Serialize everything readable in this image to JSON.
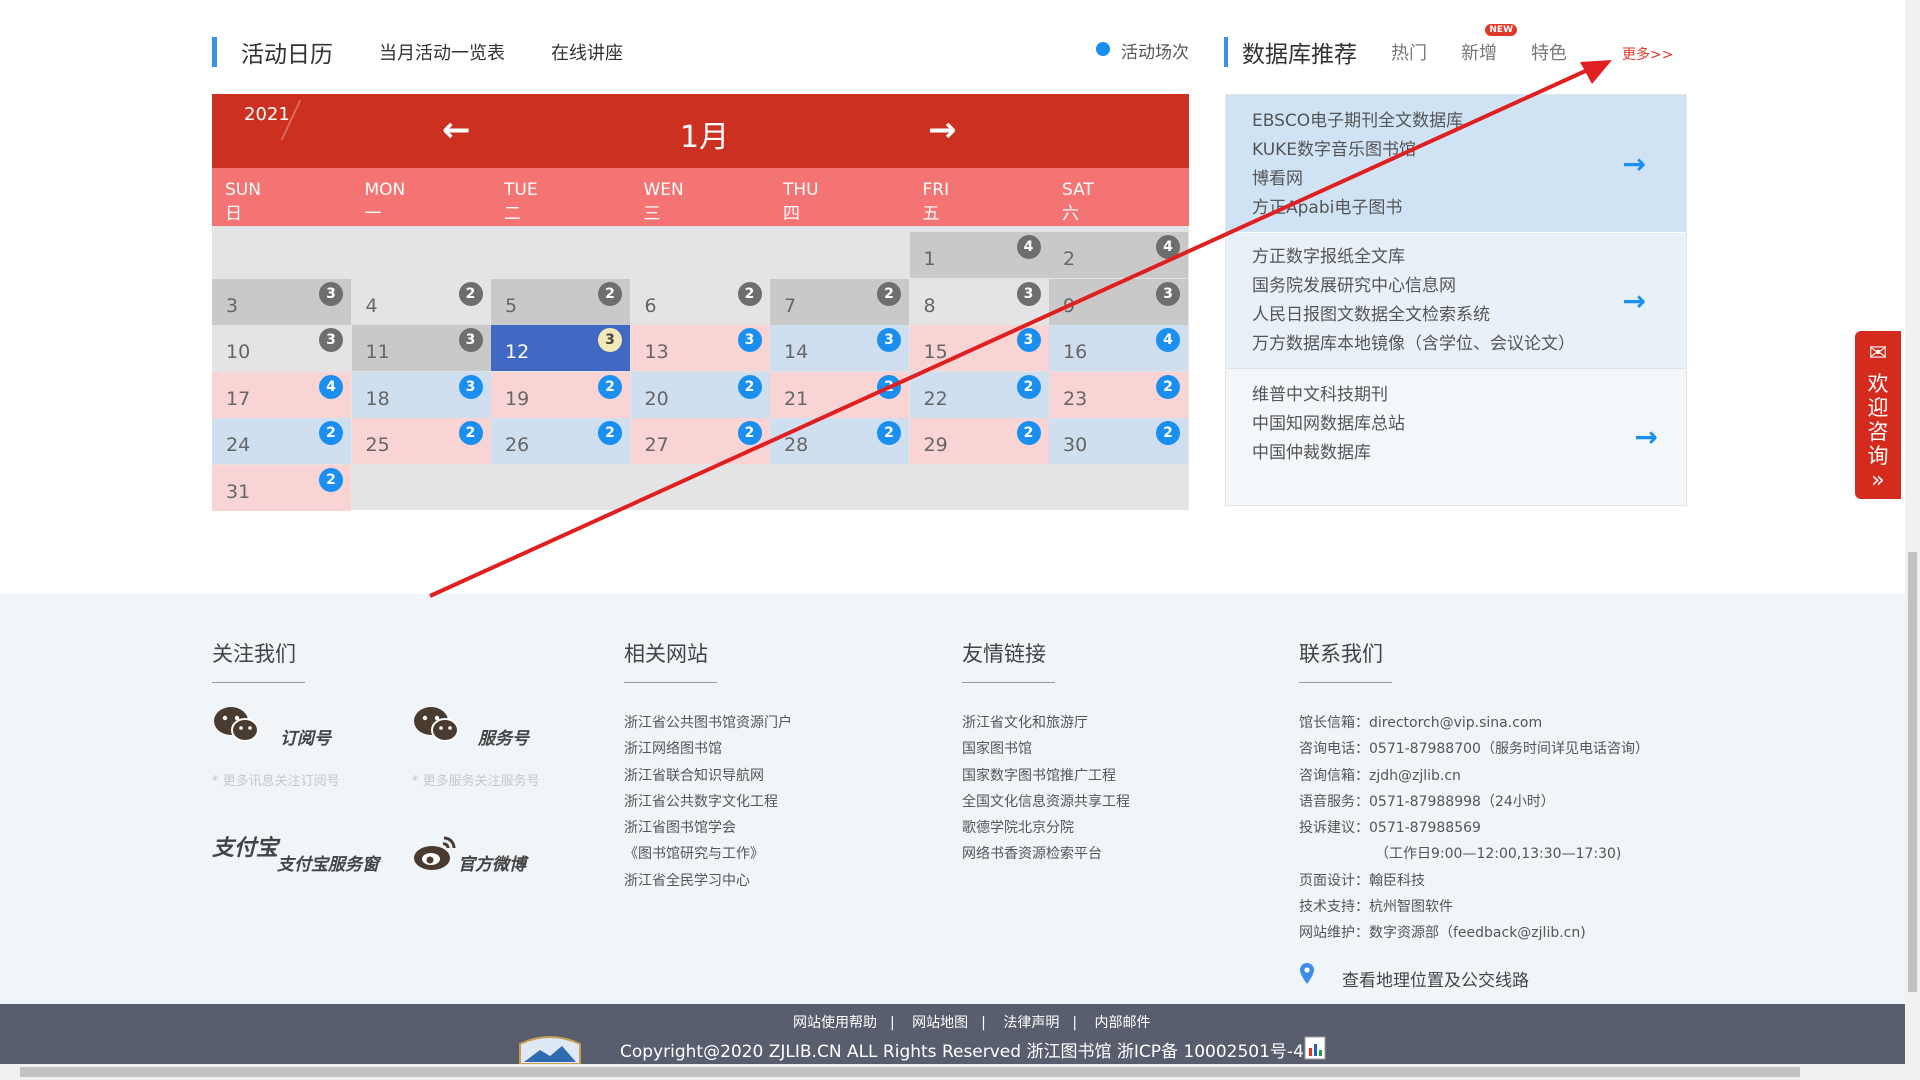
{
  "tabs": {
    "main": "活动日历",
    "monthly": "当月活动一览表",
    "lectures": "在线讲座"
  },
  "legend_label": "活动场次",
  "db_section": {
    "title": "数据库推荐",
    "hot": "热门",
    "new": "新增",
    "new_badge": "NEW",
    "featured": "特色",
    "more": "更多>>"
  },
  "calendar": {
    "year": "2021",
    "month": "1月",
    "prev_arrow": "←",
    "next_arrow": "→",
    "weekdays": [
      {
        "en": "SUN",
        "cn": "日"
      },
      {
        "en": "MON",
        "cn": "一"
      },
      {
        "en": "TUE",
        "cn": "二"
      },
      {
        "en": "WEN",
        "cn": "三"
      },
      {
        "en": "THU",
        "cn": "四"
      },
      {
        "en": "FRI",
        "cn": "五"
      },
      {
        "en": "SAT",
        "cn": "六"
      }
    ],
    "days": [
      {
        "d": "1",
        "c": "4",
        "s": "gray",
        "b": "gray"
      },
      {
        "d": "2",
        "c": "4",
        "s": "gray",
        "b": "gray"
      },
      {
        "d": "3",
        "c": "3",
        "s": "gray",
        "b": "gray"
      },
      {
        "d": "4",
        "c": "2",
        "s": "none",
        "b": "gray"
      },
      {
        "d": "5",
        "c": "2",
        "s": "gray",
        "b": "gray"
      },
      {
        "d": "6",
        "c": "2",
        "s": "none",
        "b": "gray"
      },
      {
        "d": "7",
        "c": "2",
        "s": "gray",
        "b": "gray"
      },
      {
        "d": "8",
        "c": "3",
        "s": "none",
        "b": "gray"
      },
      {
        "d": "9",
        "c": "3",
        "s": "gray",
        "b": "gray"
      },
      {
        "d": "10",
        "c": "3",
        "s": "none",
        "b": "gray"
      },
      {
        "d": "11",
        "c": "3",
        "s": "gray",
        "b": "gray"
      },
      {
        "d": "12",
        "c": "3",
        "s": "sel",
        "b": "cream"
      },
      {
        "d": "13",
        "c": "3",
        "s": "pink",
        "b": "blue"
      },
      {
        "d": "14",
        "c": "3",
        "s": "blue",
        "b": "blue"
      },
      {
        "d": "15",
        "c": "3",
        "s": "pink",
        "b": "blue"
      },
      {
        "d": "16",
        "c": "4",
        "s": "blue",
        "b": "blue"
      },
      {
        "d": "17",
        "c": "4",
        "s": "pink",
        "b": "blue"
      },
      {
        "d": "18",
        "c": "3",
        "s": "blue",
        "b": "blue"
      },
      {
        "d": "19",
        "c": "2",
        "s": "pink",
        "b": "blue"
      },
      {
        "d": "20",
        "c": "2",
        "s": "blue",
        "b": "blue"
      },
      {
        "d": "21",
        "c": "2",
        "s": "pink",
        "b": "blue"
      },
      {
        "d": "22",
        "c": "2",
        "s": "blue",
        "b": "blue"
      },
      {
        "d": "23",
        "c": "2",
        "s": "pink",
        "b": "blue"
      },
      {
        "d": "24",
        "c": "2",
        "s": "blue",
        "b": "blue"
      },
      {
        "d": "25",
        "c": "2",
        "s": "pink",
        "b": "blue"
      },
      {
        "d": "26",
        "c": "2",
        "s": "blue",
        "b": "blue"
      },
      {
        "d": "27",
        "c": "2",
        "s": "pink",
        "b": "blue"
      },
      {
        "d": "28",
        "c": "2",
        "s": "blue",
        "b": "blue"
      },
      {
        "d": "29",
        "c": "2",
        "s": "pink",
        "b": "blue"
      },
      {
        "d": "30",
        "c": "2",
        "s": "blue",
        "b": "blue"
      },
      {
        "d": "31",
        "c": "2",
        "s": "pink",
        "b": "blue"
      }
    ],
    "first_weekday_index": 5
  },
  "databases": [
    {
      "items": [
        "EBSCO电子期刊全文数据库",
        "KUKE数字音乐图书馆",
        "博看网",
        "方正Apabi电子图书"
      ]
    },
    {
      "items": [
        "方正数字报纸全文库",
        "国务院发展研究中心信息网",
        "人民日报图文数据全文检索系统",
        "万方数据库本地镜像（含学位、会议论文）"
      ]
    },
    {
      "items": [
        "维普中文科技期刊",
        "中国知网数据库总站",
        "中国仲裁数据库"
      ]
    }
  ],
  "db_arrow": "→",
  "consult_widget": {
    "text": [
      "欢",
      "迎",
      "咨",
      "询"
    ],
    "chevron": "»"
  },
  "footer": {
    "follow": {
      "title": "关注我们",
      "subscription": "订阅号",
      "subscription_hint": "* 更多讯息关注订阅号",
      "service": "服务号",
      "service_hint": "* 更多服务关注服务号",
      "alipay_logo": "支付宝",
      "alipay": "支付宝服务窗",
      "weibo": "官方微博"
    },
    "related": {
      "title": "相关网站",
      "links": [
        "浙江省公共图书馆资源门户",
        "浙江网络图书馆",
        "浙江省联合知识导航网",
        "浙江省公共数字文化工程",
        "浙江省图书馆学会",
        "《图书馆研究与工作》",
        "浙江省全民学习中心"
      ]
    },
    "friends": {
      "title": "友情链接",
      "links": [
        "浙江省文化和旅游厅",
        "国家图书馆",
        "国家数字图书馆推广工程",
        "全国文化信息资源共享工程",
        "歌德学院北京分院",
        "网络书香资源检索平台"
      ]
    },
    "contact": {
      "title": "联系我们",
      "lines": [
        "馆长信箱：directorch@vip.sina.com",
        "咨询电话：0571-87988700（服务时间详见电话咨询）",
        "咨询信箱：zjdh@zjlib.cn",
        "语音服务：0571-87988998（24小时）",
        "投诉建议：0571-87988569",
        "（工作日9:00—12:00,13:30—17:30)",
        "页面设计：翰臣科技",
        "技术支持：杭州智图软件",
        "网站维护：数字资源部（feedback@zjlib.cn)"
      ],
      "map_link": "查看地理位置及公交线路"
    },
    "bottom_links": [
      "网站使用帮助",
      "网站地图",
      "法律声明",
      "内部邮件"
    ],
    "copyright": "Copyright@2020 ZJLIB.CN ALL Rights Reserved 浙江图书馆 浙ICP备 10002501号-4"
  },
  "colors": {
    "calendar_header": "#cc3020",
    "weekday_bar": "#f47474",
    "accent_blue": "#1a8ff0",
    "annotation_arrow": "#e02020"
  }
}
